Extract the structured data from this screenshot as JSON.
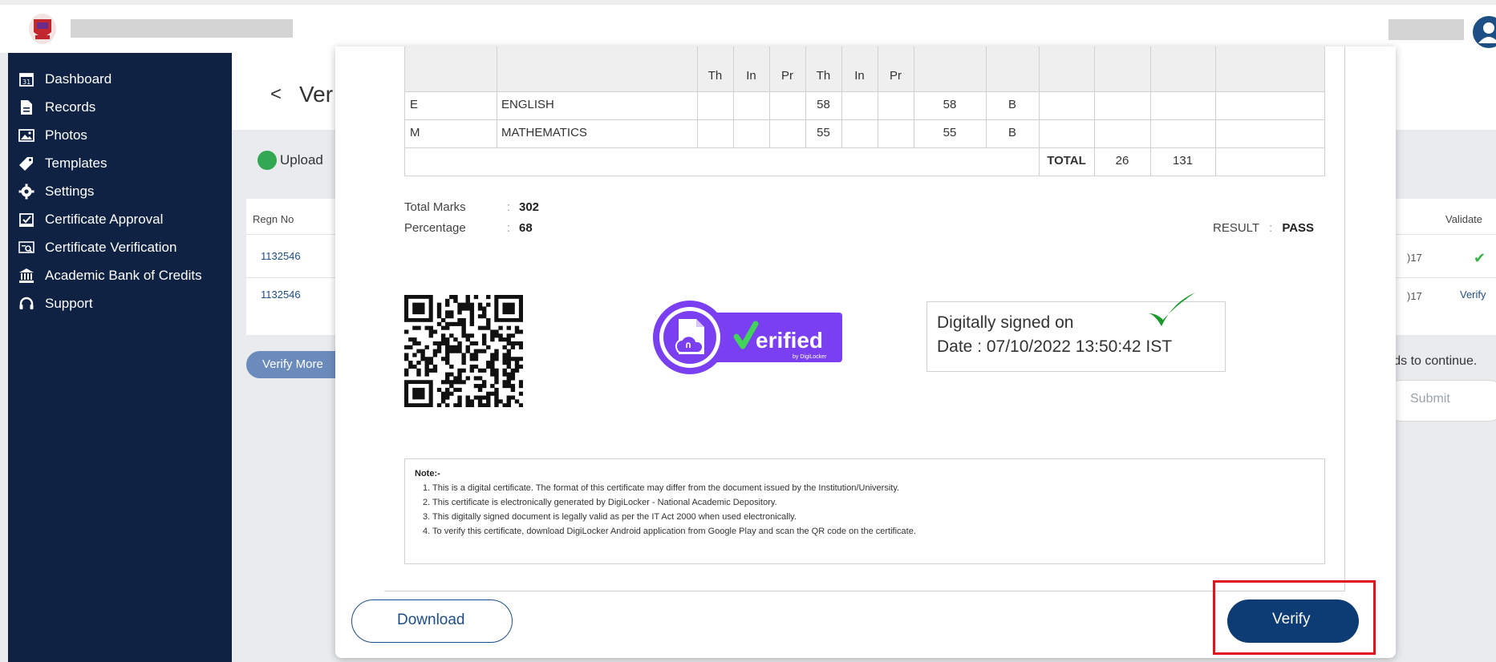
{
  "sidebar": {
    "items": [
      {
        "label": "Dashboard",
        "icon": "calendar-icon"
      },
      {
        "label": "Records",
        "icon": "document-icon"
      },
      {
        "label": "Photos",
        "icon": "photo-icon"
      },
      {
        "label": "Templates",
        "icon": "tag-icon"
      },
      {
        "label": "Settings",
        "icon": "gear-icon"
      },
      {
        "label": "Certificate Approval",
        "icon": "approval-icon"
      },
      {
        "label": "Certificate Verification",
        "icon": "verification-icon"
      },
      {
        "label": "Academic Bank of Credits",
        "icon": "bank-icon"
      },
      {
        "label": "Support",
        "icon": "headset-icon"
      }
    ]
  },
  "page": {
    "back": "<",
    "title": "Ver",
    "upload_label": "Upload",
    "table": {
      "col_regn": "Regn No",
      "col_validate": "Validate",
      "rows": [
        {
          "regn": "1132546",
          "year_fragment": ")17",
          "validate": "✔"
        },
        {
          "regn": "1132546",
          "year_fragment": ")17",
          "validate": "Verify"
        }
      ]
    },
    "verify_more": "Verify More",
    "continue_fragment": "ords to continue.",
    "submit": "Submit"
  },
  "certificate": {
    "subheads": [
      "Th",
      "In",
      "Pr",
      "Th",
      "In",
      "Pr"
    ],
    "subjects": [
      {
        "code": "E",
        "name": "ENGLISH",
        "th": "58",
        "total": "58",
        "grade": "B"
      },
      {
        "code": "M",
        "name": "MATHEMATICS",
        "th": "55",
        "total": "55",
        "grade": "B"
      }
    ],
    "total_label": "TOTAL",
    "total_credits": "26",
    "total_points": "131",
    "total_marks_label": "Total Marks",
    "total_marks_value": "302",
    "percentage_label": "Percentage",
    "percentage_value": "68",
    "colon": ":",
    "result_label": "RESULT",
    "result_value": "PASS",
    "badge_text": "erified",
    "badge_sub": "by DigiLocker",
    "signed_line1": "Digitally signed on",
    "signed_line2": "Date : 07/10/2022 13:50:42 IST",
    "note_title": "Note:-",
    "notes": [
      "1. This is a digital certificate. The format of this certificate may differ from the document issued by the Institution/University.",
      "2. This certificate is electronically generated by DigiLocker - National Academic Depository.",
      "3. This digitally signed document is legally valid as per the IT Act 2000 when used electronically.",
      "4. To verify this certificate, download DigiLocker Android application from Google Play and scan the QR code on the certificate."
    ]
  },
  "modal_actions": {
    "download": "Download",
    "verify": "Verify"
  },
  "colors": {
    "sidebar_bg": "#0f2243",
    "primary": "#0d3b74",
    "accent_green": "#3bb54a",
    "badge_purple": "#7b3ff2",
    "highlight_red": "#e0141c"
  }
}
